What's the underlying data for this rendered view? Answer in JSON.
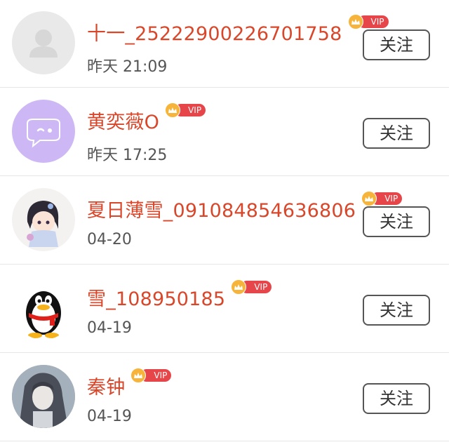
{
  "users": [
    {
      "name": "十一_25222900226701758",
      "vip_label": "VIP",
      "time": "昨天 21:09",
      "follow_label": "关注"
    },
    {
      "name": "黄奕薇O",
      "vip_label": "VIP",
      "time": "昨天 17:25",
      "follow_label": "关注"
    },
    {
      "name": "夏日薄雪_091084854636806",
      "vip_label": "VIP",
      "time": "04-20",
      "follow_label": "关注"
    },
    {
      "name": "雪_108950185",
      "vip_label": "VIP",
      "time": "04-19",
      "follow_label": "关注"
    },
    {
      "name": "秦钟",
      "vip_label": "VIP",
      "time": "04-19",
      "follow_label": "关注"
    }
  ],
  "colors": {
    "name": "#d9472b",
    "vip": "#e6454a",
    "crown": "#f6b53a",
    "time": "#555555"
  },
  "avatars": [
    "default-user-silhouette",
    "purple-chat-bubble",
    "anime-girl",
    "qq-penguin",
    "girl-portrait"
  ]
}
